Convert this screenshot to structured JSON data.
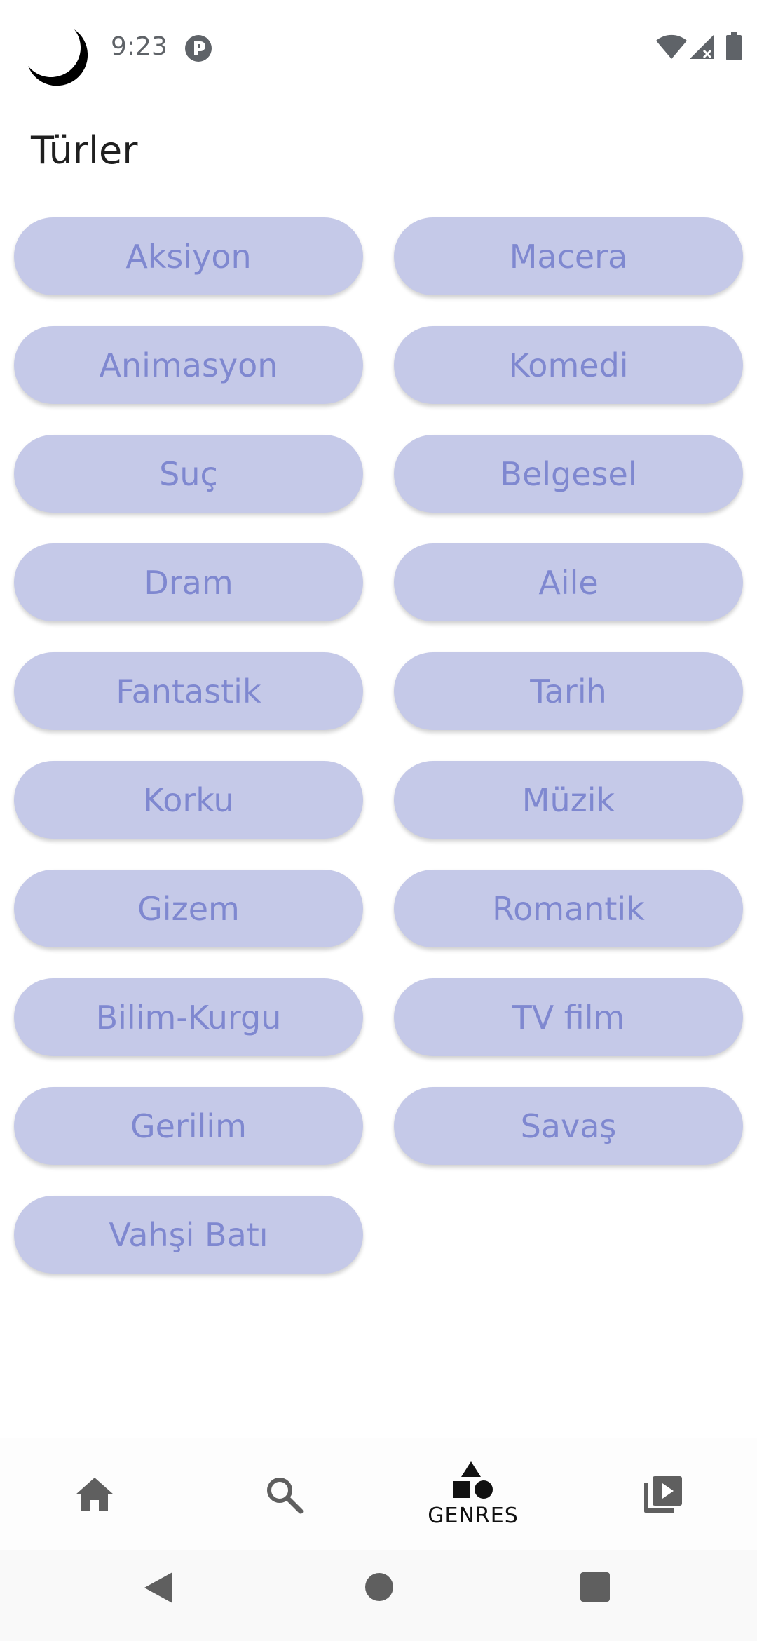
{
  "status_bar": {
    "time": "9:23",
    "icons": [
      "moon-icon",
      "notification-icon",
      "wifi-icon",
      "signal-icon",
      "battery-icon"
    ]
  },
  "page": {
    "title": "Türler"
  },
  "genres": [
    "Aksiyon",
    "Macera",
    "Animasyon",
    "Komedi",
    "Suç",
    "Belgesel",
    "Dram",
    "Aile",
    "Fantastik",
    "Tarih",
    "Korku",
    "Müzik",
    "Gizem",
    "Romantik",
    "Bilim-Kurgu",
    "TV film",
    "Gerilim",
    "Savaş",
    "Vahşi Batı"
  ],
  "bottom_nav": {
    "items": [
      {
        "icon": "home-icon",
        "label": ""
      },
      {
        "icon": "search-icon",
        "label": ""
      },
      {
        "icon": "genres-icon",
        "label": "GENRES",
        "active": true
      },
      {
        "icon": "video-library-icon",
        "label": ""
      }
    ]
  },
  "colors": {
    "chip_background": "#c5c9e8",
    "chip_text": "#7f88d0",
    "nav_icon": "#5f5f5f",
    "nav_active": "#111111"
  }
}
